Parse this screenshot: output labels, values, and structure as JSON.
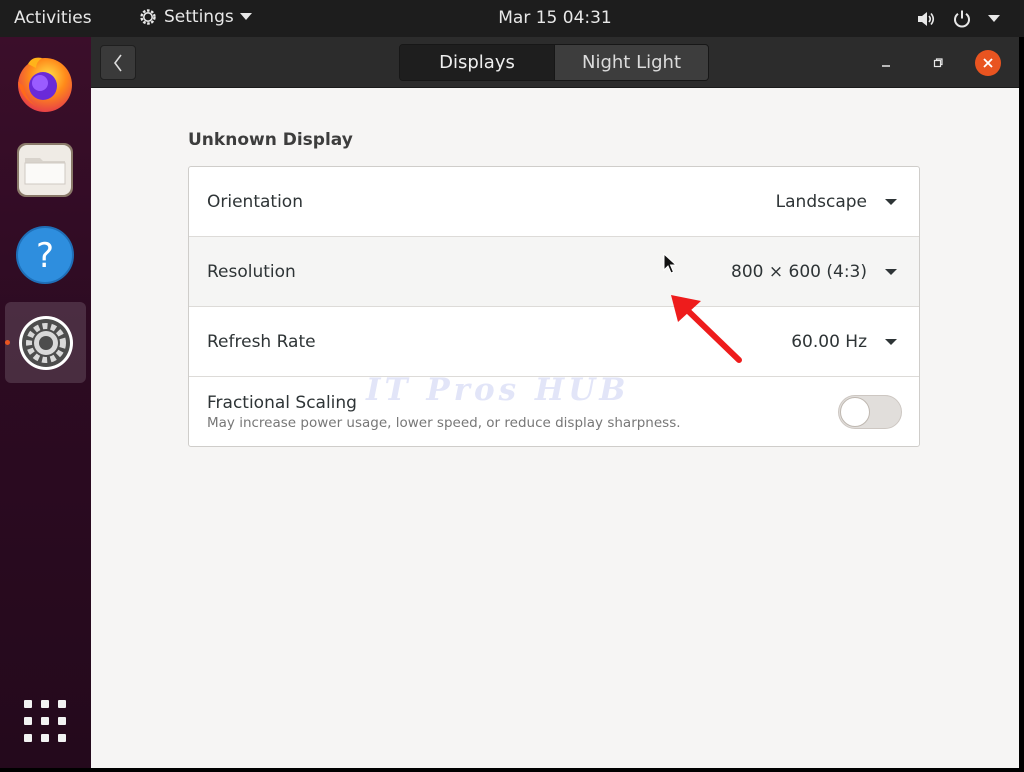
{
  "topbar": {
    "activities": "Activities",
    "app_menu": "Settings",
    "clock": "Mar 15  04:31",
    "icons": [
      "settings-gear-icon",
      "chevron-down-icon",
      "volume-icon",
      "power-icon",
      "chevron-down-icon"
    ]
  },
  "dock": {
    "items": [
      {
        "name": "firefox",
        "icon": "firefox-icon"
      },
      {
        "name": "files",
        "icon": "folder-icon"
      },
      {
        "name": "help",
        "icon": "help-icon"
      },
      {
        "name": "settings",
        "icon": "settings-gear-icon",
        "active": true
      }
    ],
    "show_apps_icon": "apps-grid-icon"
  },
  "window": {
    "tabs": [
      {
        "label": "Displays",
        "selected": true
      },
      {
        "label": "Night Light",
        "selected": false
      }
    ],
    "section_title": "Unknown Display",
    "rows": [
      {
        "label": "Orientation",
        "value": "Landscape"
      },
      {
        "label": "Resolution",
        "value": "800 × 600 (4:3)"
      },
      {
        "label": "Refresh Rate",
        "value": "60.00 Hz"
      }
    ],
    "fractional_scaling": {
      "label": "Fractional Scaling",
      "description": "May increase power usage, lower speed, or reduce display sharpness.",
      "enabled": false
    }
  },
  "overlay": {
    "watermark": "IT Pros HUB",
    "annotation": "red-arrow-icon"
  },
  "colors": {
    "accent": "#e95420",
    "headerbar": "#2c2c2c",
    "content_bg": "#f6f5f4",
    "annotation_red": "#ee1c1c"
  }
}
